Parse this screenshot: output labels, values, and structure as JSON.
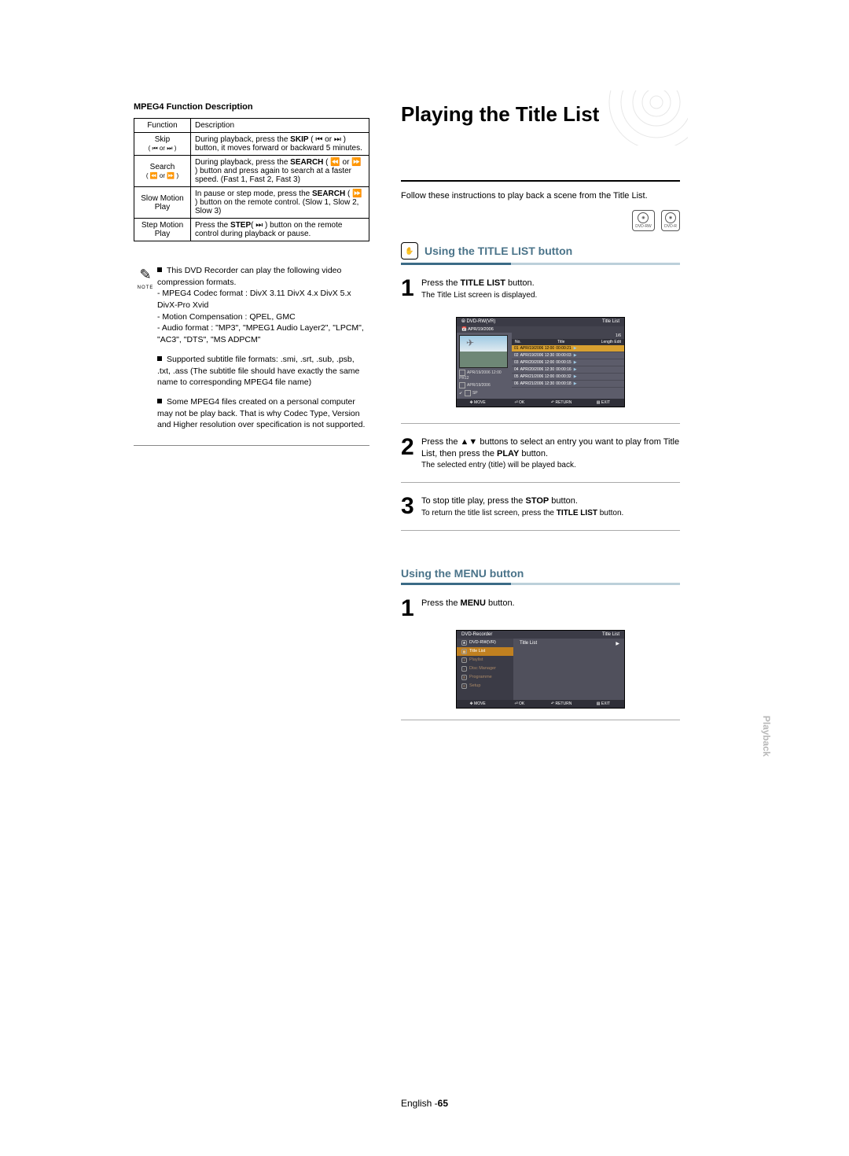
{
  "left": {
    "mpeg_title": "MPEG4 Function Description",
    "table": {
      "h1": "Function",
      "h2": "Description",
      "rows": [
        {
          "func": "Skip",
          "funcIcons": "( ⏮ or ⏭ )",
          "desc_a": "During playback, press the ",
          "desc_b": "SKIP",
          "desc_c": " ( ⏮ or ⏭ ) button, it moves forward or backward 5 minutes."
        },
        {
          "func": "Search",
          "funcIcons": "( ⏪ or ⏩ )",
          "desc_a": "During playback, press the ",
          "desc_b": "SEARCH",
          "desc_c": " ( ⏪ or ⏩ ) button and press again to search at a faster speed. (Fast 1, Fast 2, Fast 3)"
        },
        {
          "func": "Slow Motion Play",
          "funcIcons": "",
          "desc_a": "In pause or step mode, press the ",
          "desc_b": "SEARCH",
          "desc_c": " ( ⏩ ) button on the remote control. (Slow 1, Slow 2, Slow 3)"
        },
        {
          "func": "Step Motion Play",
          "funcIcons": "",
          "desc_a": "Press the ",
          "desc_b": "STEP",
          "desc_c": "( ⏭ ) button on the remote control during playback or pause."
        }
      ]
    },
    "note": {
      "label": "NOTE",
      "items": [
        {
          "type": "block",
          "lead": "This DVD Recorder can play the following video compression formats.",
          "sub": [
            "MPEG4 Codec format : DivX 3.11 DivX 4.x DivX 5.x DivX-Pro Xvid",
            "Motion Compensation : QPEL, GMC",
            "Audio format : \"MP3\", \"MPEG1 Audio Layer2\", \"LPCM\", \"AC3\", \"DTS\", \"MS ADPCM\""
          ]
        },
        {
          "type": "para",
          "text": "Supported subtitle file formats: .smi, .srt, .sub, .psb, .txt, .ass (The subtitle file should have exactly the same name to corresponding MPEG4 file name)"
        },
        {
          "type": "para",
          "text": "Some MPEG4 files created on a personal computer may not be play back. That is why Codec Type, Version and Higher resolution over specification is not supported."
        }
      ]
    }
  },
  "right": {
    "hero": "Playing the Title List",
    "intro": "Follow these instructions to play back a scene from the Title List.",
    "discs": [
      "DVD-RW",
      "DVD-R"
    ],
    "sectionA": "Using the TITLE LIST button",
    "step1_a": "Press the ",
    "step1_b": "TITLE LIST",
    "step1_c": " button.",
    "step1_sub": "The Title List screen is displayed.",
    "step2_a": "Press the ▲▼ buttons to select an entry you want to play from Title List, then press the ",
    "step2_b": "PLAY",
    "step2_c": " button.",
    "step2_sub": "The selected entry (title) will be played back.",
    "step3_a": "To stop title play, press the ",
    "step3_b": "STOP",
    "step3_c": " button.",
    "step3_sub_a": "To return the title list screen, press the ",
    "step3_sub_b": "TITLE LIST",
    "step3_sub_c": " button.",
    "sectionB": "Using the MENU button",
    "stepB1_a": "Press the ",
    "stepB1_b": "MENU",
    "stepB1_c": " button."
  },
  "osd1": {
    "disc": "DVD-RW(VR)",
    "title": "Title List",
    "date": "📅 APR/19/2006",
    "count": "1/6",
    "cols": {
      "no": "No.",
      "title": "Title",
      "length": "Length",
      "edit": "Edit"
    },
    "rows": [
      {
        "n": "01",
        "t": "APR/19/2006 12:00",
        "l": "00:00:21"
      },
      {
        "n": "02",
        "t": "APR/19/2006 12:30",
        "l": "00:00:03"
      },
      {
        "n": "03",
        "t": "APR/20/2006 12:00",
        "l": "00:00:15"
      },
      {
        "n": "04",
        "t": "APR/20/2006 12:30",
        "l": "00:00:16"
      },
      {
        "n": "05",
        "t": "APR/21/2006 12:00",
        "l": "00:00:32"
      },
      {
        "n": "06",
        "t": "APR/21/2006 12:30",
        "l": "00:00:18"
      }
    ],
    "meta1": "APR/19/2006 12:00 PR12",
    "meta2": "APR/19/2006",
    "meta3": "SP",
    "foot": {
      "move": "✥ MOVE",
      "ok": "⏎ OK",
      "return": "↶ RETURN",
      "exit": "▤ EXIT"
    }
  },
  "osd2": {
    "top_left": "DVD-Recorder",
    "top_right": "Title List",
    "disc": "DVD-RW(VR)",
    "side": [
      {
        "label": "Title List",
        "sel": true
      },
      {
        "label": "Playlist"
      },
      {
        "label": "Disc Manager"
      },
      {
        "label": "Programme"
      },
      {
        "label": "Setup"
      }
    ],
    "main_label": "Title List",
    "foot": {
      "move": "✥ MOVE",
      "ok": "⏎ OK",
      "return": "↶ RETURN",
      "exit": "▤ EXIT"
    }
  },
  "tab": "Playback",
  "footer": {
    "lang": "English -",
    "page": "65"
  }
}
